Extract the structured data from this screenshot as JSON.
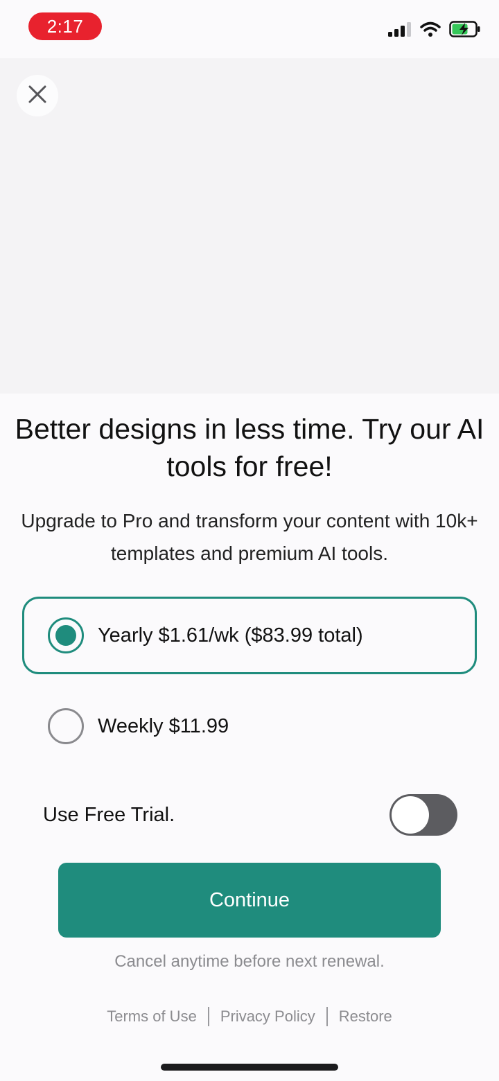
{
  "status_bar": {
    "time": "2:17",
    "icons": [
      "cellular-signal-icon",
      "wifi-icon",
      "battery-charging-icon"
    ]
  },
  "close_icon": "close-icon",
  "headline": "Better designs in less time. Try our AI tools for free!",
  "subtext": "Upgrade to Pro and transform your content with 10k+ templates and premium AI tools.",
  "plans": [
    {
      "label": "Yearly $1.61/wk ($83.99 total)",
      "selected": true
    },
    {
      "label": "Weekly $11.99",
      "selected": false
    }
  ],
  "trial": {
    "label": "Use Free Trial.",
    "enabled": false
  },
  "continue_label": "Continue",
  "cancel_note": "Cancel anytime before next renewal.",
  "footer": {
    "terms": "Terms of Use",
    "privacy": "Privacy Policy",
    "restore": "Restore"
  },
  "colors": {
    "accent": "#1f8c7d",
    "time_pill": "#e8222e",
    "toggle_off": "#5c5c60",
    "battery_charge": "#35c759"
  }
}
